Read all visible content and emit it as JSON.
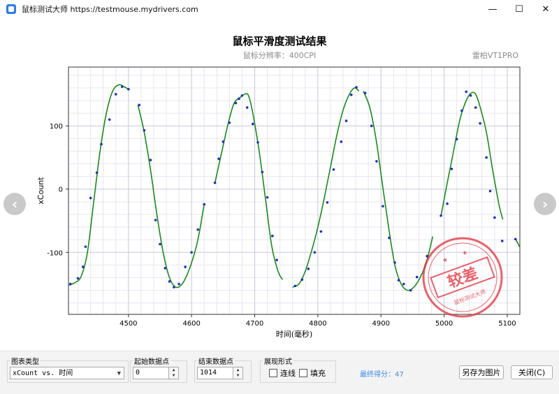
{
  "window": {
    "title": "鼠标测试大师 https://testmouse.mydrivers.com",
    "buttons": {
      "minimize": "—",
      "maximize": "☐",
      "close": "✕"
    }
  },
  "header": {
    "title": "鼠标平滑度测试结果",
    "subtitle": "鼠标分辨率：400CPI",
    "device": "雷柏VT1PRO"
  },
  "stamp": {
    "text": "较差",
    "outer_text": "鼠标测试大师",
    "color": "#e0303a"
  },
  "nav": {
    "prev_icon": "‹",
    "next_icon": "›"
  },
  "chart_data": {
    "type": "line",
    "xlabel": "时间(毫秒)",
    "ylabel": "xCount",
    "xlim": [
      4405,
      5120
    ],
    "ylim": [
      -198,
      193
    ],
    "x_ticks": [
      4500,
      4600,
      4700,
      4800,
      4900,
      5000,
      5100
    ],
    "y_ticks": [
      100,
      0,
      -100
    ],
    "grid": true,
    "line_color": "#1a8a1a",
    "point_color": "#1f2fc0",
    "segments": [
      {
        "x": [
          4405,
          4415,
          4425,
          4435,
          4445,
          4455,
          4465,
          4475,
          4485,
          4493,
          4500
        ],
        "y": [
          -152,
          -148,
          -138,
          -100,
          -20,
          60,
          120,
          155,
          165,
          162,
          158
        ]
      },
      {
        "x": [
          4515,
          4525,
          4535,
          4545,
          4555,
          4565,
          4575,
          4585,
          4595,
          4605,
          4612,
          4620
        ],
        "y": [
          133,
          90,
          30,
          -40,
          -100,
          -140,
          -155,
          -150,
          -130,
          -100,
          -70,
          -23
        ]
      },
      {
        "x": [
          4637,
          4647,
          4657,
          4667,
          4677,
          4684,
          4690,
          4697,
          4707,
          4717,
          4727,
          4737,
          4744
        ],
        "y": [
          10,
          55,
          100,
          135,
          145,
          150,
          148,
          120,
          60,
          -15,
          -90,
          -130,
          -143
        ]
      },
      {
        "x": [
          4760,
          4770,
          4780,
          4790,
          4800,
          4810,
          4820,
          4830,
          4840,
          4850,
          4858,
          4865
        ],
        "y": [
          -155,
          -150,
          -130,
          -98,
          -60,
          -15,
          35,
          85,
          125,
          150,
          160,
          155
        ]
      },
      {
        "x": [
          4872,
          4882,
          4892,
          4902,
          4912,
          4922,
          4932,
          4942,
          4952,
          4962,
          4972,
          4982
        ],
        "y": [
          155,
          130,
          80,
          10,
          -60,
          -120,
          -150,
          -160,
          -155,
          -140,
          -115,
          -75
        ]
      },
      {
        "x": [
          4995,
          5005,
          5015,
          5025,
          5035,
          5043,
          5050,
          5057,
          5067,
          5077,
          5087,
          5093
        ],
        "y": [
          -42,
          10,
          60,
          110,
          140,
          152,
          150,
          130,
          90,
          30,
          -25,
          -48
        ]
      },
      {
        "x": [
          5113,
          5120
        ],
        "y": [
          -78,
          -92
        ]
      }
    ],
    "points": {
      "x": [
        4408,
        4420,
        4428,
        4432,
        4440,
        4450,
        4457,
        4470,
        4480,
        4490,
        4500,
        4517,
        4525,
        4535,
        4543,
        4550,
        4558,
        4565,
        4572,
        4580,
        4590,
        4600,
        4610,
        4620,
        4637,
        4643,
        4650,
        4660,
        4670,
        4675,
        4680,
        4688,
        4697,
        4705,
        4712,
        4720,
        4728,
        4735,
        4764,
        4775,
        4785,
        4795,
        4805,
        4815,
        4825,
        4837,
        4845,
        4853,
        4861,
        4875,
        4885,
        4893,
        4903,
        4913,
        4922,
        4928,
        4936,
        4947,
        4957,
        4973,
        4995,
        5005,
        5012,
        5020,
        5028,
        5035,
        5042,
        5050,
        5057,
        5067,
        5073,
        5080,
        5092,
        5113
      ],
      "y": [
        -150,
        -141,
        -123,
        -91,
        -14,
        26,
        71,
        110,
        150,
        162,
        158,
        133,
        93,
        46,
        -49,
        -87,
        -125,
        -146,
        -155,
        -150,
        -123,
        -100,
        -64,
        -24,
        10,
        48,
        75,
        105,
        136,
        143,
        148,
        129,
        103,
        74,
        27,
        -13,
        -74,
        -112,
        -153,
        -143,
        -126,
        -100,
        -67,
        -21,
        31,
        75,
        108,
        149,
        161,
        152,
        100,
        44,
        -27,
        -77,
        -116,
        -144,
        -150,
        -160,
        -139,
        -106,
        -42,
        -23,
        32,
        79,
        124,
        154,
        148,
        129,
        104,
        50,
        -3,
        -45,
        -82,
        -79
      ]
    }
  },
  "controls": {
    "chart_type": {
      "label": "图表类型",
      "value": "xCount vs. 时间"
    },
    "start_point": {
      "label": "起始数据点",
      "value": "0"
    },
    "end_point": {
      "label": "结束数据点",
      "value": "1014"
    },
    "display": {
      "label": "展现形式",
      "line_label": "连线",
      "fill_label": "填充"
    },
    "score": "最终得分：47",
    "save_button": "另存为图片",
    "close_button": "关闭(C)"
  }
}
